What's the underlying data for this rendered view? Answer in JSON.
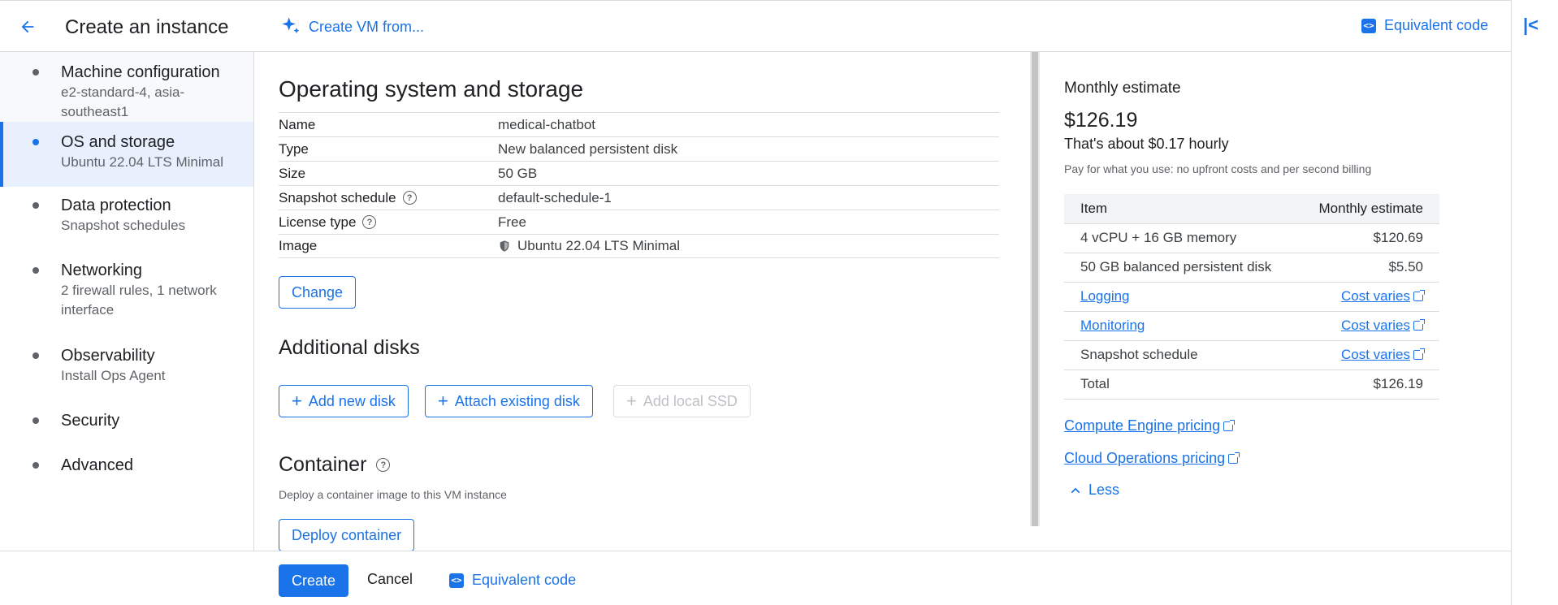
{
  "header": {
    "title": "Create an instance",
    "create_vm_from": "Create VM from...",
    "equivalent_code": "Equivalent code"
  },
  "sidebar": {
    "items": [
      {
        "title": "Machine configuration",
        "sub": "e2-standard-4, asia-southeast1"
      },
      {
        "title": "OS and storage",
        "sub": "Ubuntu 22.04 LTS Minimal"
      },
      {
        "title": "Data protection",
        "sub": "Snapshot schedules"
      },
      {
        "title": "Networking",
        "sub": "2 firewall rules, 1 network interface"
      },
      {
        "title": "Observability",
        "sub": "Install Ops Agent"
      },
      {
        "title": "Security",
        "sub": ""
      },
      {
        "title": "Advanced",
        "sub": ""
      }
    ]
  },
  "main": {
    "os_title": "Operating system and storage",
    "properties": [
      {
        "key": "Name",
        "value": "medical-chatbot"
      },
      {
        "key": "Type",
        "value": "New balanced persistent disk"
      },
      {
        "key": "Size",
        "value": "50 GB"
      },
      {
        "key": "Snapshot schedule",
        "value": "default-schedule-1"
      },
      {
        "key": "License type",
        "value": "Free"
      },
      {
        "key": "Image",
        "value": "Ubuntu 22.04 LTS Minimal"
      }
    ],
    "change_label": "Change",
    "additional_disks_title": "Additional disks",
    "add_new_disk": "Add new disk",
    "attach_existing_disk": "Attach existing disk",
    "add_local_ssd": "Add local SSD",
    "container_title": "Container",
    "container_desc": "Deploy a container image to this VM instance",
    "deploy_container": "Deploy container"
  },
  "estimate": {
    "title": "Monthly estimate",
    "total": "$126.19",
    "hourly": "That's about $0.17 hourly",
    "note": "Pay for what you use: no upfront costs and per second billing",
    "col_item": "Item",
    "col_estimate": "Monthly estimate",
    "rows": [
      {
        "item": "4 vCPU + 16 GB memory",
        "cost": "$120.69"
      },
      {
        "item": "50 GB balanced persistent disk",
        "cost": "$5.50"
      },
      {
        "item": "Logging",
        "cost": "Cost varies"
      },
      {
        "item": "Monitoring",
        "cost": "Cost varies"
      },
      {
        "item": "Snapshot schedule",
        "cost": "Cost varies"
      },
      {
        "item": "Total",
        "cost": "$126.19"
      }
    ],
    "ce_pricing": "Compute Engine pricing",
    "co_pricing": "Cloud Operations pricing",
    "less": "Less"
  },
  "footer": {
    "create": "Create",
    "cancel": "Cancel",
    "equivalent_code": "Equivalent code"
  }
}
